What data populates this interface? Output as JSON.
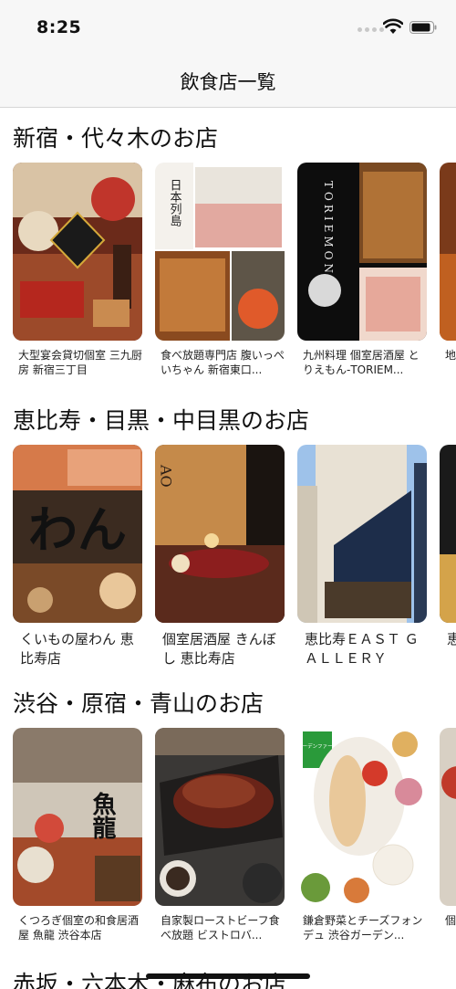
{
  "status_bar": {
    "time": "8:25"
  },
  "nav": {
    "title": "飲食店一覧"
  },
  "sections": [
    {
      "title": "新宿・代々木のお店",
      "cards": [
        {
          "label": "大型宴会貸切個室 三九厨房 新宿三丁目"
        },
        {
          "label": "食べ放題専門店 腹いっぺいちゃん 新宿東口...",
          "sign_text": "日本列島"
        },
        {
          "label": "九州料理 個室居酒屋 とりえもん-TORIEM...",
          "sign_text": "TORIEMON"
        },
        {
          "label": "地とり"
        }
      ]
    },
    {
      "title": "恵比寿・目黒・中目黒のお店",
      "cards": [
        {
          "label": "くいもの屋わん 恵比寿店",
          "sign_text": "わん"
        },
        {
          "label": "個室居酒屋 きんぼし 恵比寿店",
          "sign_text": "AO"
        },
        {
          "label": "恵比寿ＥＡＳＴ ＧＡＬＬＥＲＹ"
        },
        {
          "label": "恵 V"
        }
      ]
    },
    {
      "title": "渋谷・原宿・青山のお店",
      "cards": [
        {
          "label": "くつろぎ個室の和食居酒屋 魚龍 渋谷本店",
          "sign_text": "魚龍"
        },
        {
          "label": "自家製ローストビーフ食べ放題 ビストロバ..."
        },
        {
          "label": "鎌倉野菜とチーズフォンデュ 渋谷ガーデン...",
          "sign_text": "ガーデンファーム"
        },
        {
          "label": "個 和"
        }
      ]
    },
    {
      "title": "赤坂・六本木・麻布のお店"
    }
  ]
}
